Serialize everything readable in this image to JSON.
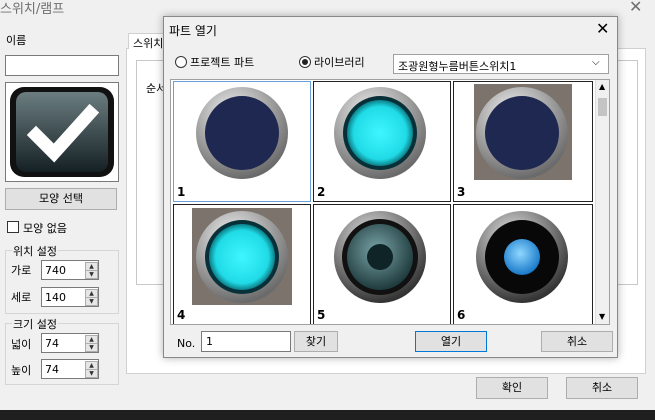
{
  "background_window": {
    "title": "스위치/램프",
    "close_glyph": "✕",
    "name_label": "이름",
    "name_value": "",
    "shape_select_button": "모양 선택",
    "no_shape_label": "모양 없음",
    "position_group": "위치 설정",
    "x_label": "가로",
    "x_value": "740",
    "y_label": "세로",
    "y_value": "140",
    "size_group": "크기 설정",
    "width_label": "넓이",
    "width_value": "74",
    "height_label": "높이",
    "height_value": "74",
    "tab_label": "스위치",
    "ok_button": "확인",
    "cancel_button": "취소",
    "inner_label": "순서"
  },
  "dialog": {
    "title": "파트 열기",
    "close_glyph": "✕",
    "radio_project": "프로젝트 파트",
    "radio_library": "라이브러리",
    "library_selected": "조광원형누름버튼스위치1",
    "no_label": "No.",
    "no_value": "1",
    "find_button": "찾기",
    "open_button": "열기",
    "cancel_button": "취소",
    "parts": [
      {
        "num": "1",
        "style": "dark-navy"
      },
      {
        "num": "2",
        "style": "cyan-lit"
      },
      {
        "num": "3",
        "style": "dark-navy-square"
      },
      {
        "num": "4",
        "style": "cyan-square"
      },
      {
        "num": "5",
        "style": "teal-ring"
      },
      {
        "num": "6",
        "style": "blue-dot"
      }
    ]
  },
  "colors": {
    "navy": "#1e2850",
    "cyan": "#28e8f0",
    "select_border": "#6aa0d8"
  }
}
